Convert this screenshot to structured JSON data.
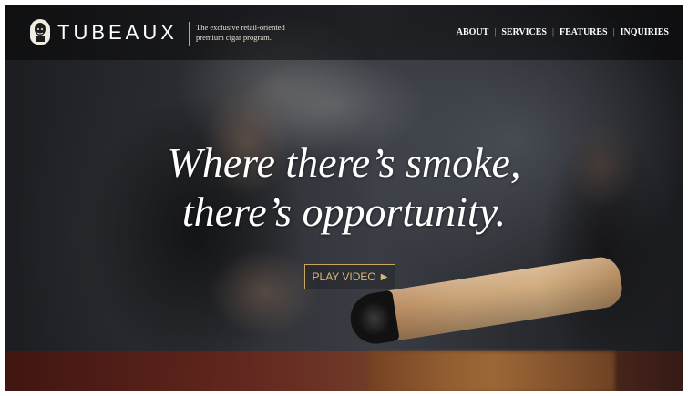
{
  "header": {
    "brand": "TUBEAUX",
    "tagline_line1": "The exclusive retail-oriented",
    "tagline_line2": "premium cigar program.",
    "logo_icon": "gentleman-emblem-icon"
  },
  "nav": {
    "items": [
      {
        "label": "ABOUT"
      },
      {
        "label": "SERVICES"
      },
      {
        "label": "FEATURES"
      },
      {
        "label": "INQUIRIES"
      }
    ],
    "separator": "|"
  },
  "hero": {
    "headline_line1": "Where there’s smoke,",
    "headline_line2": "there’s opportunity.",
    "cta_label": "PLAY VIDEO",
    "cta_icon": "play-triangle-icon",
    "cta_icon_glyph": "▶"
  },
  "colors": {
    "accent_gold": "#c9a760",
    "header_overlay": "rgba(0,0,0,0.45)",
    "headline_text": "#ffffff"
  }
}
